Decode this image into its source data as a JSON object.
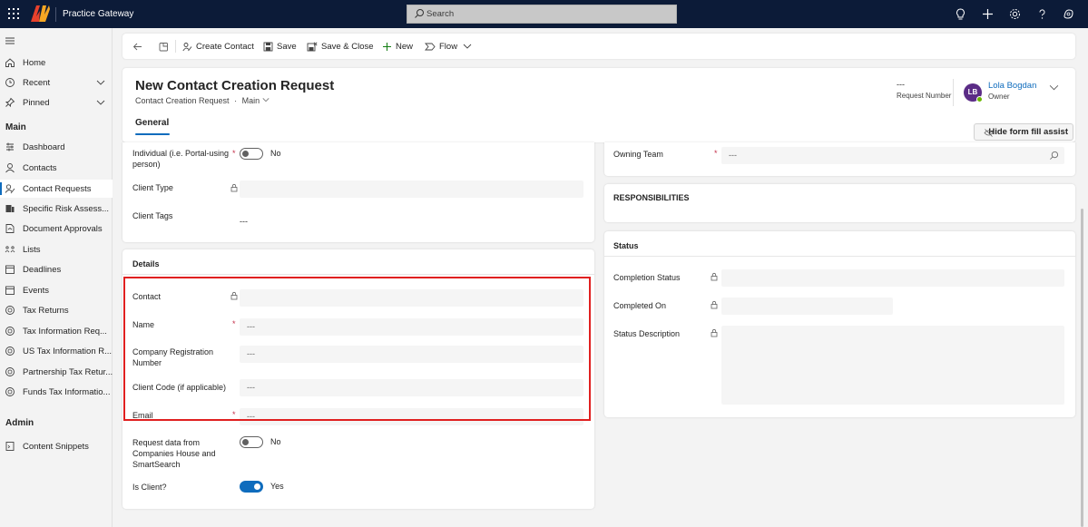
{
  "app": {
    "name": "Practice Gateway",
    "search_placeholder": "Search"
  },
  "topbar_icons": [
    "lightbulb-icon",
    "plus-icon",
    "settings-icon",
    "help-icon",
    "copilot-icon"
  ],
  "nav": {
    "top": [
      {
        "label": "Home",
        "icon": "home-icon"
      },
      {
        "label": "Recent",
        "icon": "clock-icon",
        "chevron": true
      },
      {
        "label": "Pinned",
        "icon": "pin-icon",
        "chevron": true
      }
    ],
    "main_section": "Main",
    "main": [
      {
        "label": "Dashboard",
        "icon": "dashboard-icon"
      },
      {
        "label": "Contacts",
        "icon": "person-icon"
      },
      {
        "label": "Contact Requests",
        "icon": "person-request-icon",
        "active": true
      },
      {
        "label": "Specific Risk Assess...",
        "icon": "risk-icon"
      },
      {
        "label": "Document Approvals",
        "icon": "document-approval-icon"
      },
      {
        "label": "Lists",
        "icon": "list-icon"
      },
      {
        "label": "Deadlines",
        "icon": "calendar-icon"
      },
      {
        "label": "Events",
        "icon": "calendar-icon"
      },
      {
        "label": "Tax Returns",
        "icon": "globe-icon"
      },
      {
        "label": "Tax Information Req...",
        "icon": "globe-icon"
      },
      {
        "label": "US Tax Information R...",
        "icon": "globe-icon"
      },
      {
        "label": "Partnership Tax Retur...",
        "icon": "globe-icon"
      },
      {
        "label": "Funds Tax Informatio...",
        "icon": "globe-icon"
      }
    ],
    "admin_section": "Admin",
    "admin": [
      {
        "label": "Content Snippets",
        "icon": "snippet-icon"
      }
    ]
  },
  "commands": {
    "create_contact": "Create Contact",
    "save": "Save",
    "save_close": "Save & Close",
    "new": "New",
    "flow": "Flow"
  },
  "header": {
    "title": "New Contact Creation Request",
    "entity": "Contact Creation Request",
    "separator": "·",
    "form": "Main",
    "request_number_value": "---",
    "request_number_label": "Request Number",
    "owner_initials": "LB",
    "owner_name": "Lola Bogdan",
    "owner_label": "Owner",
    "tab_general": "General",
    "hide_assist": "Hide form fill assist"
  },
  "left_top_card": {
    "individual_label": "Individual (i.e. Portal-using person)",
    "individual_value": "No",
    "client_type_label": "Client Type",
    "client_tags_label": "Client Tags",
    "client_tags_value": "---"
  },
  "details": {
    "heading": "Details",
    "contact_label": "Contact",
    "name_label": "Name",
    "name_value": "---",
    "company_reg_label": "Company Registration Number",
    "company_reg_value": "---",
    "client_code_label": "Client Code (if applicable)",
    "client_code_value": "---",
    "email_label": "Email",
    "email_value": "---",
    "request_data_label": "Request data from Companies House and SmartSearch",
    "request_data_value": "No",
    "is_client_label": "Is Client?",
    "is_client_value": "Yes"
  },
  "owning_team": {
    "label": "Owning Team",
    "value": "---"
  },
  "responsibilities": {
    "heading": "RESPONSIBILITIES"
  },
  "status": {
    "heading": "Status",
    "completion_status_label": "Completion Status",
    "completed_on_label": "Completed On",
    "status_description_label": "Status Description"
  },
  "required_mark": "*"
}
